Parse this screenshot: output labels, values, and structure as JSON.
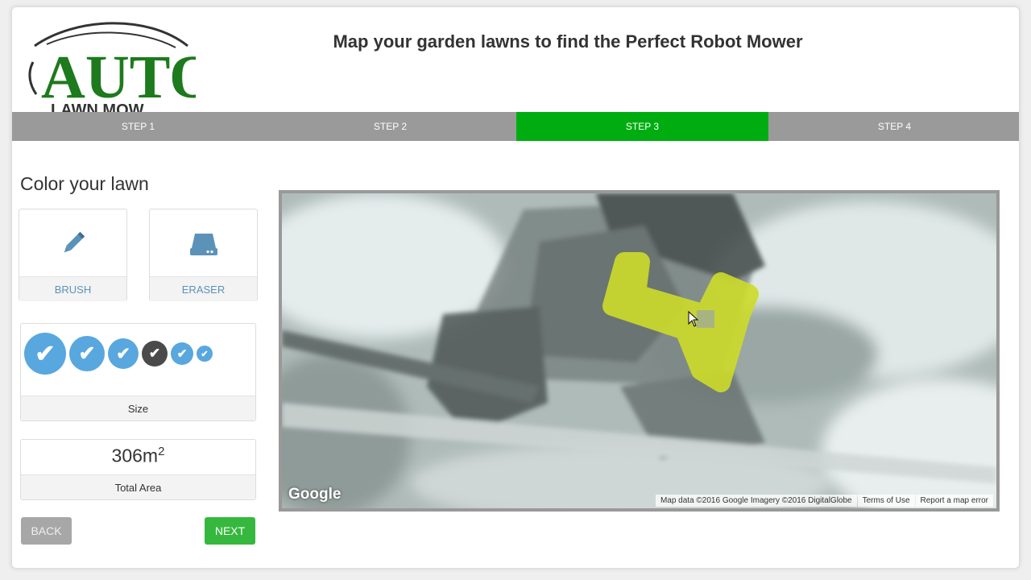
{
  "header": {
    "logo_word": "AUTO",
    "logo_sub": "LAWN MOW",
    "title": "Map your garden lawns to find the Perfect Robot Mower"
  },
  "steps": [
    "STEP 1",
    "STEP 2",
    "STEP 3",
    "STEP 4"
  ],
  "active_step": 3,
  "sidebar": {
    "section_title": "Color your lawn",
    "tools": {
      "brush": "BRUSH",
      "eraser": "ERASER"
    },
    "size_label": "Size",
    "selected_size_index": 3,
    "area_value": "306m",
    "area_exponent": "2",
    "area_label": "Total Area",
    "back_label": "BACK",
    "next_label": "NEXT"
  },
  "map": {
    "google_logo": "Google",
    "attribution": "Map data ©2016 Google Imagery ©2016 DigitalGlobe",
    "terms": "Terms of Use",
    "report": "Report a map error"
  },
  "colors": {
    "accent_green": "#00ad11",
    "next_green": "#36b83e",
    "brush_blue": "#59a7df",
    "lawn_paint": "#cddc2a"
  }
}
